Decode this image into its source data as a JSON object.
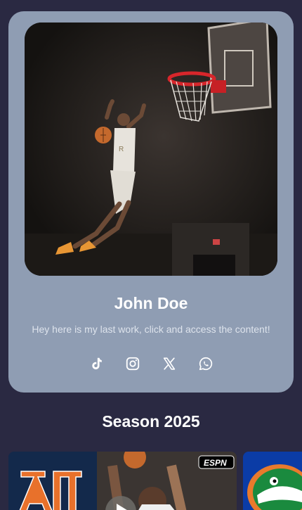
{
  "profile": {
    "name": "John Doe",
    "bio": "Hey here is my last work, click and access the content!",
    "photo_icon": "basketball-dunk-photo"
  },
  "socials": [
    {
      "name": "tiktok",
      "icon": "tiktok-icon"
    },
    {
      "name": "instagram",
      "icon": "instagram-icon"
    },
    {
      "name": "x",
      "icon": "x-icon"
    },
    {
      "name": "whatsapp",
      "icon": "whatsapp-icon"
    }
  ],
  "section": {
    "title": "Season 2025"
  },
  "carousel": {
    "items": [
      {
        "label": "AU",
        "badge": "ESPN",
        "icon": "play-icon"
      },
      {
        "label": "Florida Gators",
        "icon": "gator-logo"
      }
    ]
  },
  "colors": {
    "background": "#2a2942",
    "card": "#8f9db3",
    "text": "#ffffff",
    "subtext": "#dde3ec"
  }
}
